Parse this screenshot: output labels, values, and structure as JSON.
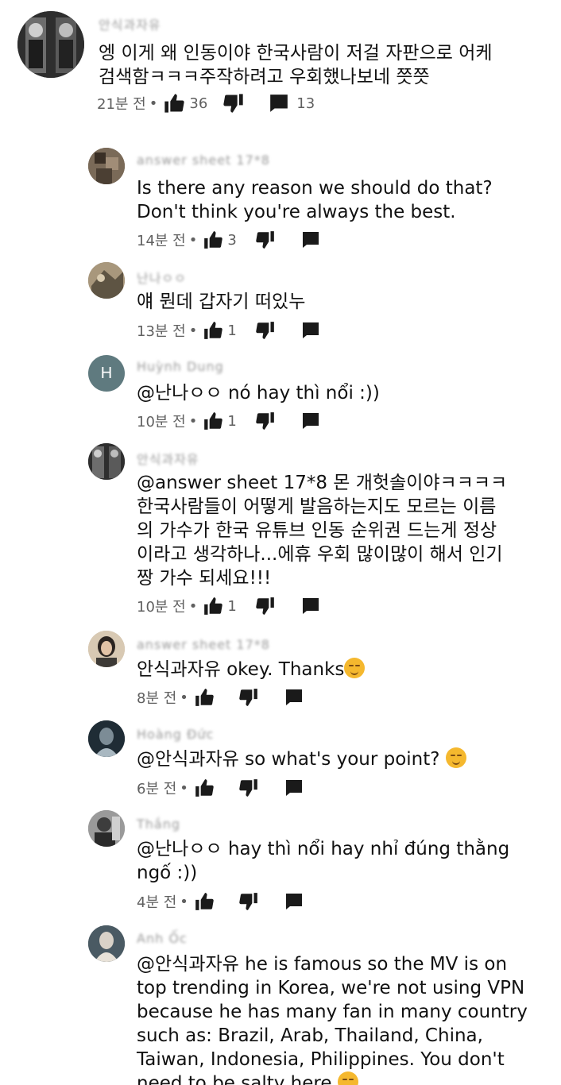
{
  "comments": [
    {
      "author": "안식과자유",
      "text": "엥 이게 왜 인동이야  한국사람이 저걸 자판으로 어케 검색함ㅋㅋㅋ주작하려고 우회했나보네 쯧쯧",
      "time": "21분 전",
      "likes": "36",
      "replies": "13"
    },
    {
      "author": "answer sheet 17*8",
      "text": "Is there any reason we should do that?\nDon't think you're always the best.",
      "time": "14분 전",
      "likes": "3"
    },
    {
      "author": "난나ㅇㅇ",
      "text": "얘 뭔데 갑자기 떠있누",
      "time": "13분 전",
      "likes": "1"
    },
    {
      "author": "Huỳnh Dung",
      "avatar_letter": "H",
      "text": "@난나ㅇㅇ nó hay thì nổi :))",
      "time": "10분 전",
      "likes": "1"
    },
    {
      "author": "안식과자유",
      "text": "@answer sheet 17*8 몬 개헛솔이야ㅋㅋㅋㅋ\n한국사람들이 어떻게 발음하는지도 모르는 이름\n의 가수가 한국 유튜브 인동 순위권 드는게 정상\n이라고 생각하나...에휴 우회 많이많이 해서 인기\n짱 가수 되세요!!!",
      "time": "10분 전",
      "likes": "1"
    },
    {
      "author": "answer sheet 17*8",
      "text": "안식과자유 okey. Thanks",
      "time": "8분 전",
      "likes": ""
    },
    {
      "author": "Hoàng Đức",
      "text": "@안식과자유 so what's your point?",
      "time": "6분 전",
      "likes": ""
    },
    {
      "author": "Thắng",
      "text": "@난나ㅇㅇ hay thì nổi hay nhỉ đúng thằng\nngố :))",
      "time": "4분 전",
      "likes": ""
    },
    {
      "author": "Anh Ốc",
      "text": "@안식과자유 he is famous so the MV is on\ntop trending in Korea, we're not using VPN\nbecause he has many fan in many country\nsuch as: Brazil, Arab, Thailand, China,\nTaiwan, Indonesia, Philippines. You don't\nneed to be salty here",
      "time": "",
      "likes": ""
    }
  ],
  "meta_separator": "•",
  "icons": {
    "like": "thumbs-up-icon",
    "dislike": "thumbs-down-icon",
    "reply": "reply-comment-icon"
  }
}
